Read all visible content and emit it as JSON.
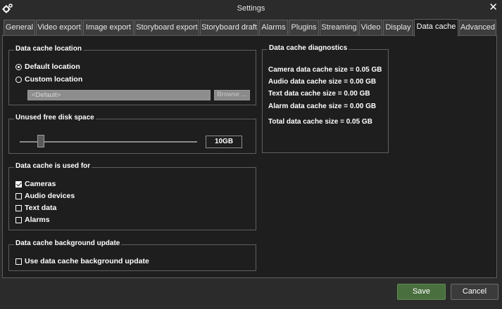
{
  "window": {
    "title": "Settings",
    "close_glyph": "✕",
    "icon": "gears-icon"
  },
  "tabs": [
    {
      "label": "General"
    },
    {
      "label": "Video export"
    },
    {
      "label": "Image export"
    },
    {
      "label": "Storyboard export"
    },
    {
      "label": "Storyboard draft"
    },
    {
      "label": "Alarms"
    },
    {
      "label": "Plugins"
    },
    {
      "label": "Streaming"
    },
    {
      "label": "Video"
    },
    {
      "label": "Display"
    },
    {
      "label": "Data cache"
    },
    {
      "label": "Advanced"
    }
  ],
  "active_tab": "Data cache",
  "location": {
    "title": "Data cache location",
    "default_label": "Default location",
    "custom_label": "Custom location",
    "selected": "default",
    "path_value": "<Default>",
    "browse_label": "Browse ..."
  },
  "disk": {
    "title": "Unused free disk space",
    "value": "10GB",
    "slider_fraction": 0.11
  },
  "used_for": {
    "title": "Data cache is used for",
    "items": [
      {
        "label": "Cameras",
        "checked": true
      },
      {
        "label": "Audio devices",
        "checked": false
      },
      {
        "label": "Text data",
        "checked": false
      },
      {
        "label": "Alarms",
        "checked": false
      }
    ]
  },
  "background": {
    "title": "Data cache background update",
    "option_label": "Use data cache background update",
    "checked": false
  },
  "diagnostics": {
    "title": "Data cache diagnostics",
    "lines": [
      "Camera data cache size = 0.05 GB",
      "Audio data cache size = 0.00 GB",
      "Text data cache size = 0.00 GB",
      "Alarm data cache size = 0.00 GB",
      "Total data cache size = 0.05 GB"
    ]
  },
  "buttons": {
    "save": "Save",
    "cancel": "Cancel"
  },
  "colors": {
    "background": "#2b2b2b",
    "panel": "#1e1e1e",
    "save_button": "#4a6f3f",
    "border": "#5f5f5f"
  }
}
